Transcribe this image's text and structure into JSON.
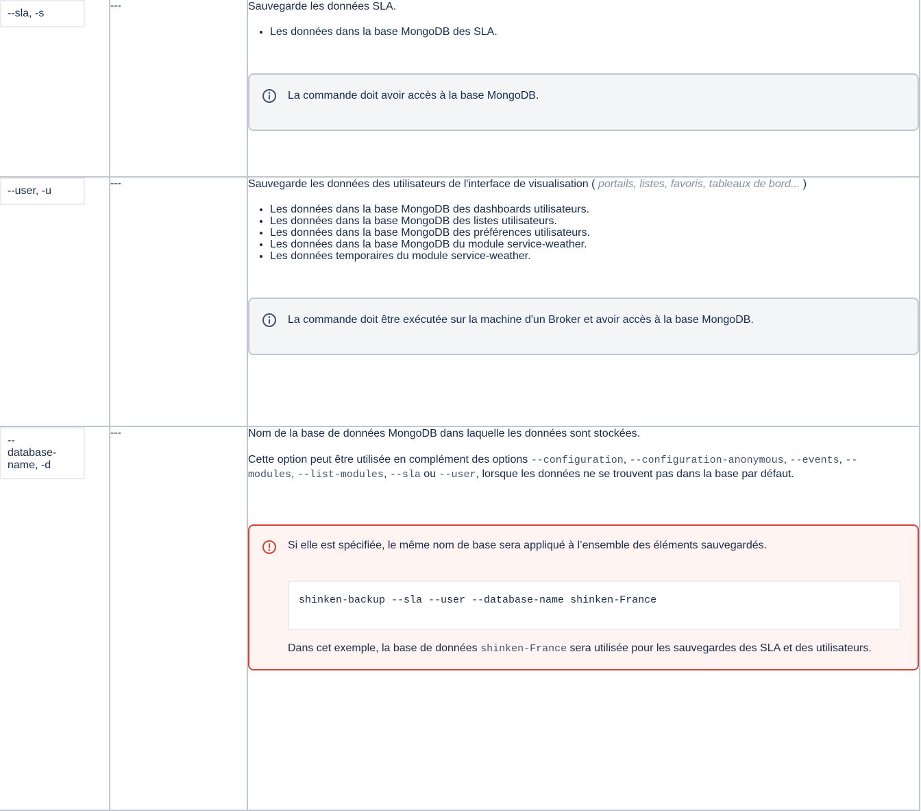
{
  "rows": [
    {
      "option": "--sla, -s",
      "default": "---",
      "description": "Sauvegarde les données SLA.",
      "bullets": [
        "Les données dans la base MongoDB des SLA."
      ],
      "info": "La commande doit avoir accès à la base MongoDB."
    },
    {
      "option": "--user, -u",
      "default": "---",
      "description_before": "Sauvegarde les données des utilisateurs de l'interface de visualisation (",
      "description_link": "portails, listes, favoris, tableaux de bord...",
      "description_after": ")",
      "bullets": [
        "Les données dans la base MongoDB des dashboards utilisateurs.",
        "Les données dans la base MongoDB des listes utilisateurs.",
        "Les données dans la base MongoDB des préférences utilisateurs.",
        "Les données dans la base MongoDB du module service-weather.",
        "Les données temporaires du module service-weather."
      ],
      "info": "La commande doit être exécutée sur la machine d'un Broker et avoir accès à la base MongoDB."
    },
    {
      "option_lines": [
        "--",
        "database-",
        "name, -d"
      ],
      "default": "---",
      "description": "Nom de la base de données MongoDB dans laquelle les données sont stockées.",
      "p2_parts": [
        {
          "t": "Cette option peut être utilisée en complément des options ",
          "code": false
        },
        {
          "t": "--configuration",
          "code": true
        },
        {
          "t": ", ",
          "code": false
        },
        {
          "t": "--configuration-anonymous",
          "code": true
        },
        {
          "t": ", ",
          "code": false
        },
        {
          "t": "--events",
          "code": true
        },
        {
          "t": ", ",
          "code": false
        },
        {
          "t": "--modules",
          "code": true
        },
        {
          "t": ", ",
          "code": false
        },
        {
          "t": "--list-modules",
          "code": true
        },
        {
          "t": ", ",
          "code": false
        },
        {
          "t": "--sla",
          "code": true
        },
        {
          "t": " ou ",
          "code": false
        },
        {
          "t": "--user",
          "code": true
        },
        {
          "t": ", lorsque les données ne se trouvent pas dans la base par défaut.",
          "code": false
        }
      ],
      "warning": "Si elle est spécifiée, le même nom de base sera appliqué à l’ensemble des éléments sauvegardés.",
      "code": "shinken-backup --sla --user --database-name shinken-France",
      "example_before": "Dans cet exemple, la base de données ",
      "example_code": "shinken-France",
      "example_after": " sera utilisée pour les sauvegardes des SLA et des utilisateurs."
    }
  ],
  "colors": {
    "info_icon": "#42526e",
    "error_icon": "#d04437",
    "border": "#c1c7d0"
  },
  "icons": {
    "info": "info-circle-icon",
    "error": "exclamation-circle-icon"
  }
}
